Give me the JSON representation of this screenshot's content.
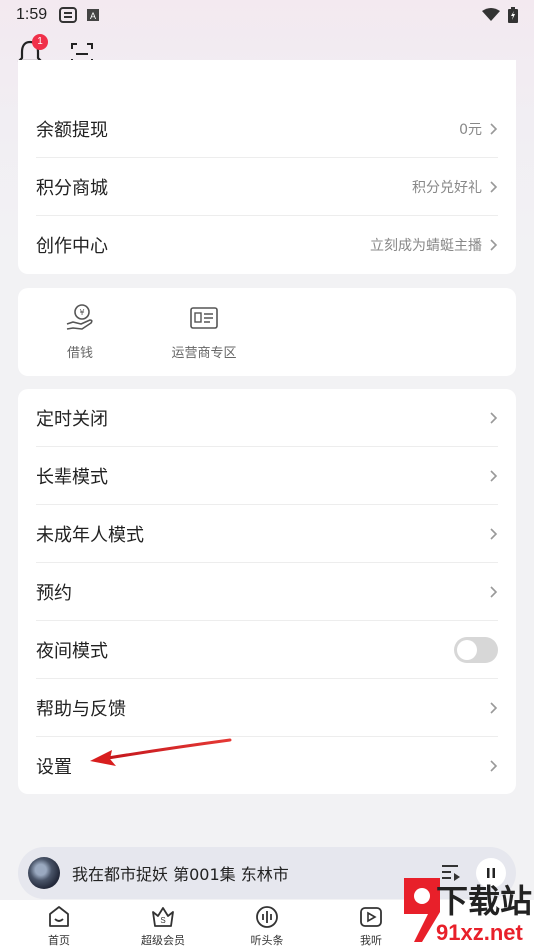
{
  "status_bar": {
    "time": "1:59"
  },
  "notifications": {
    "badge_count": "1"
  },
  "account_menu": {
    "items": [
      {
        "label": "余额提现",
        "value": "0元"
      },
      {
        "label": "积分商城",
        "value": "积分兑好礼"
      },
      {
        "label": "创作中心",
        "value": "立刻成为蜻蜓主播"
      }
    ]
  },
  "tools": {
    "items": [
      {
        "label": "借钱",
        "icon": "loan-icon"
      },
      {
        "label": "运营商专区",
        "icon": "carrier-icon"
      }
    ]
  },
  "settings_menu": {
    "items": [
      {
        "label": "定时关闭"
      },
      {
        "label": "长辈模式"
      },
      {
        "label": "未成年人模式"
      },
      {
        "label": "预约"
      },
      {
        "label": "夜间模式",
        "toggle": "off"
      },
      {
        "label": "帮助与反馈"
      },
      {
        "label": "设置"
      }
    ]
  },
  "player": {
    "title": "我在都市捉妖 第001集 东林市"
  },
  "tabbar": {
    "items": [
      {
        "label": "首页"
      },
      {
        "label": "超级会员"
      },
      {
        "label": "听头条"
      },
      {
        "label": "我听"
      }
    ]
  },
  "watermark": {
    "text1": "下载站",
    "text2": "91xz.net"
  },
  "colors": {
    "badge": "#f0304a",
    "arrow": "#d81e1e",
    "watermark_red": "#e8202a"
  }
}
